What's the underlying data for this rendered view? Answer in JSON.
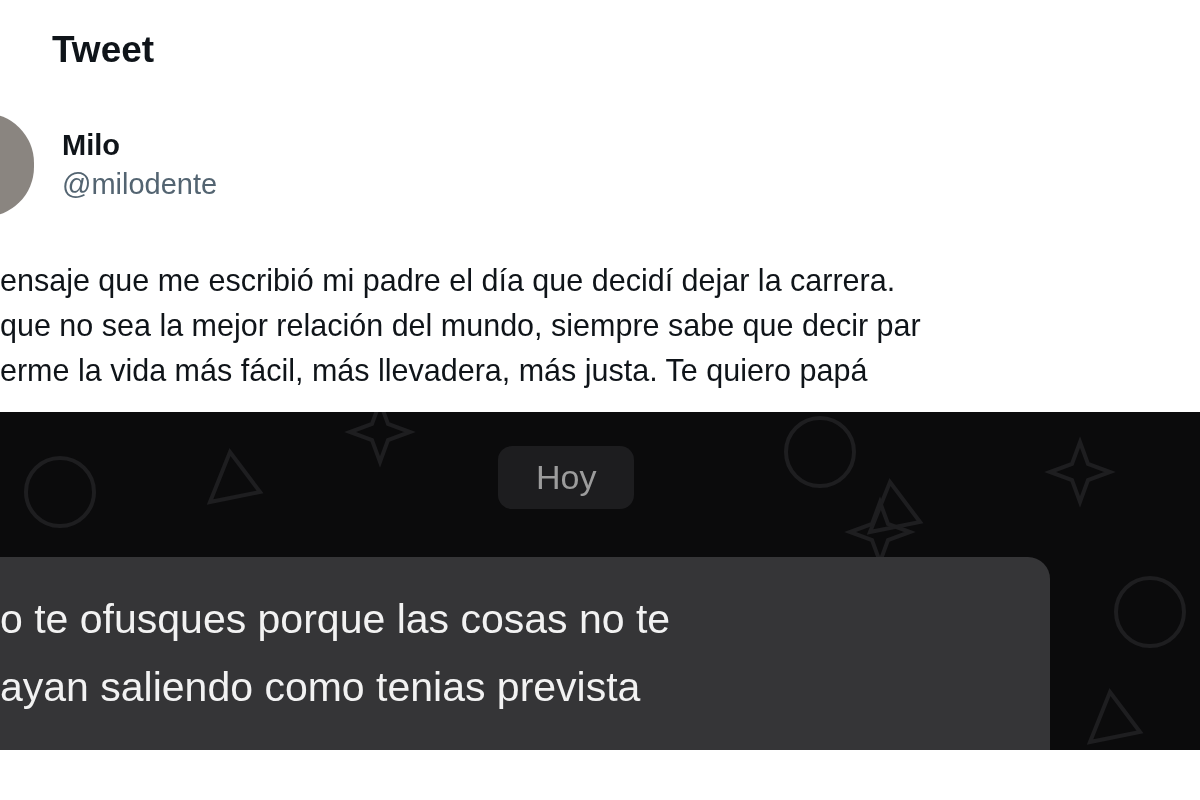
{
  "header": {
    "title": "Tweet"
  },
  "author": {
    "name": "Milo",
    "handle": "@milodente"
  },
  "tweet_lines": [
    "ensaje que me escribió mi padre el día que decidí dejar la carrera.",
    "que no sea la mejor relación del mundo, siempre sabe que decir par",
    "erme la vida más fácil, más llevadera, más justa. Te quiero papá"
  ],
  "chat_screenshot": {
    "date_label": "Hoy",
    "message_lines": [
      "o te ofusques porque las cosas no te",
      "ayan saliendo como tenias prevista"
    ]
  }
}
